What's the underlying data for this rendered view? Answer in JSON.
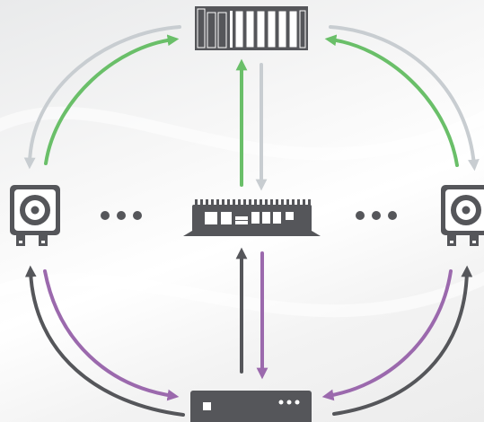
{
  "diagram": {
    "nodes": [
      {
        "id": "plc-rack",
        "icon": "plc-rack-icon"
      },
      {
        "id": "camera-left",
        "icon": "camera-icon"
      },
      {
        "id": "camera-right",
        "icon": "camera-icon"
      },
      {
        "id": "edge-gateway",
        "icon": "edge-gateway-icon"
      },
      {
        "id": "network-switch",
        "icon": "network-switch-icon"
      }
    ],
    "ellipsis_markers": [
      {
        "id": "more-devices-left",
        "icon": "ellipsis-icon"
      },
      {
        "id": "more-devices-right",
        "icon": "ellipsis-icon"
      }
    ],
    "connections": [
      {
        "from": "camera-left",
        "to": "plc-rack",
        "color": "green"
      },
      {
        "from": "plc-rack",
        "to": "camera-left",
        "color": "light-gray"
      },
      {
        "from": "camera-right",
        "to": "plc-rack",
        "color": "green"
      },
      {
        "from": "plc-rack",
        "to": "camera-right",
        "color": "light-gray"
      },
      {
        "from": "edge-gateway",
        "to": "plc-rack",
        "color": "green"
      },
      {
        "from": "plc-rack",
        "to": "edge-gateway",
        "color": "light-gray"
      },
      {
        "from": "camera-left",
        "to": "network-switch",
        "color": "purple"
      },
      {
        "from": "network-switch",
        "to": "camera-left",
        "color": "dark-gray"
      },
      {
        "from": "camera-right",
        "to": "network-switch",
        "color": "purple"
      },
      {
        "from": "network-switch",
        "to": "camera-right",
        "color": "dark-gray"
      },
      {
        "from": "edge-gateway",
        "to": "network-switch",
        "color": "purple"
      },
      {
        "from": "network-switch",
        "to": "edge-gateway",
        "color": "dark-gray"
      }
    ]
  },
  "colors": {
    "green": "#6abf69",
    "light-gray": "#c8cdd1",
    "purple": "#9b69ad",
    "dark-gray": "#55565a",
    "device": "#55565a",
    "device-highlight": "#ffffff"
  }
}
